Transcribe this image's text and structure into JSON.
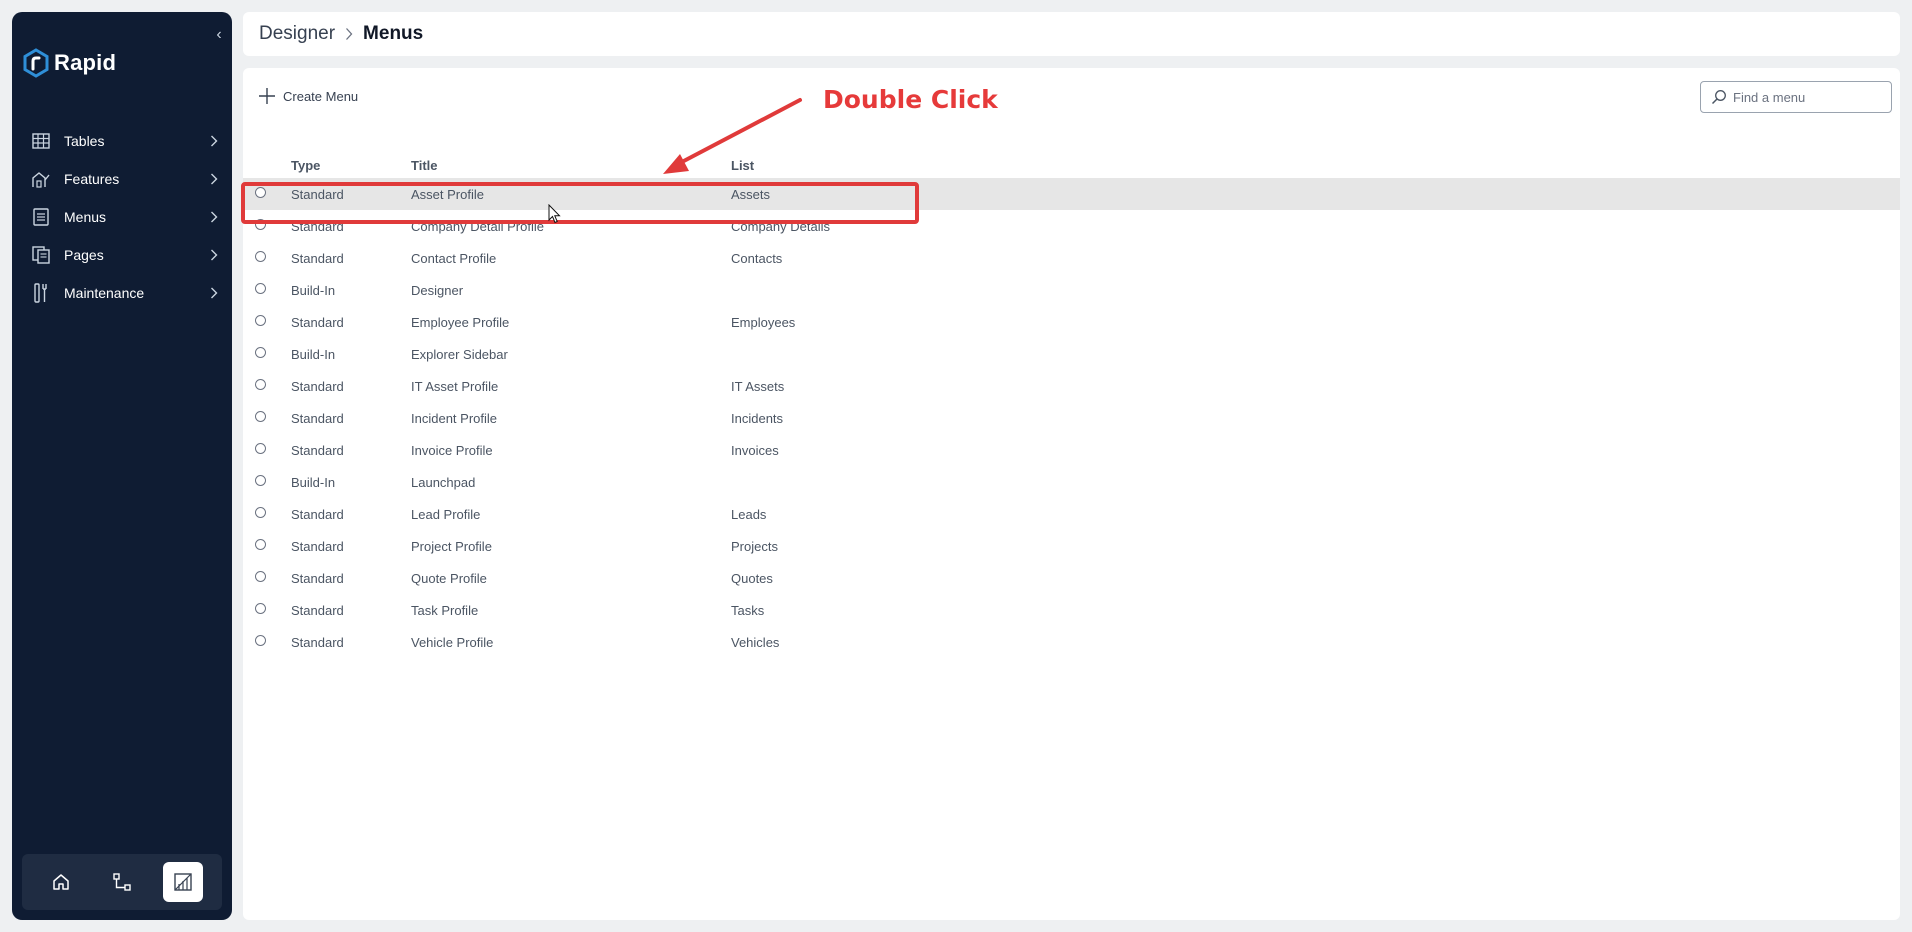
{
  "app": {
    "name": "Rapid"
  },
  "breadcrumb": {
    "root": "Designer",
    "current": "Menus"
  },
  "sidebar": {
    "items": [
      {
        "label": "Tables",
        "icon": "table-icon"
      },
      {
        "label": "Features",
        "icon": "features-icon"
      },
      {
        "label": "Menus",
        "icon": "menu-list-icon"
      },
      {
        "label": "Pages",
        "icon": "pages-icon"
      },
      {
        "label": "Maintenance",
        "icon": "maintenance-icon"
      }
    ],
    "bottom_buttons": [
      "home-icon",
      "workflow-icon",
      "designer-icon"
    ]
  },
  "toolbar": {
    "create_label": "Create Menu",
    "search_placeholder": "Find a menu"
  },
  "table": {
    "columns": [
      "Type",
      "Title",
      "List"
    ],
    "rows": [
      {
        "type": "Standard",
        "title": "Asset Profile",
        "list": "Assets"
      },
      {
        "type": "Standard",
        "title": "Company Detail Profile",
        "list": "Company Details"
      },
      {
        "type": "Standard",
        "title": "Contact Profile",
        "list": "Contacts"
      },
      {
        "type": "Build-In",
        "title": "Designer",
        "list": ""
      },
      {
        "type": "Standard",
        "title": "Employee Profile",
        "list": "Employees"
      },
      {
        "type": "Build-In",
        "title": "Explorer Sidebar",
        "list": ""
      },
      {
        "type": "Standard",
        "title": "IT Asset Profile",
        "list": "IT Assets"
      },
      {
        "type": "Standard",
        "title": "Incident Profile",
        "list": "Incidents"
      },
      {
        "type": "Standard",
        "title": "Invoice Profile",
        "list": "Invoices"
      },
      {
        "type": "Build-In",
        "title": "Launchpad",
        "list": ""
      },
      {
        "type": "Standard",
        "title": "Lead Profile",
        "list": "Leads"
      },
      {
        "type": "Standard",
        "title": "Project Profile",
        "list": "Projects"
      },
      {
        "type": "Standard",
        "title": "Quote Profile",
        "list": "Quotes"
      },
      {
        "type": "Standard",
        "title": "Task Profile",
        "list": "Tasks"
      },
      {
        "type": "Standard",
        "title": "Vehicle Profile",
        "list": "Vehicles"
      }
    ]
  },
  "annotation": {
    "label": "Double Click",
    "color": "#e03a3a"
  },
  "colors": {
    "sidebar_bg": "#0f1c33",
    "accent": "#2f8fd8",
    "highlight_row": "#e6e6e6"
  }
}
